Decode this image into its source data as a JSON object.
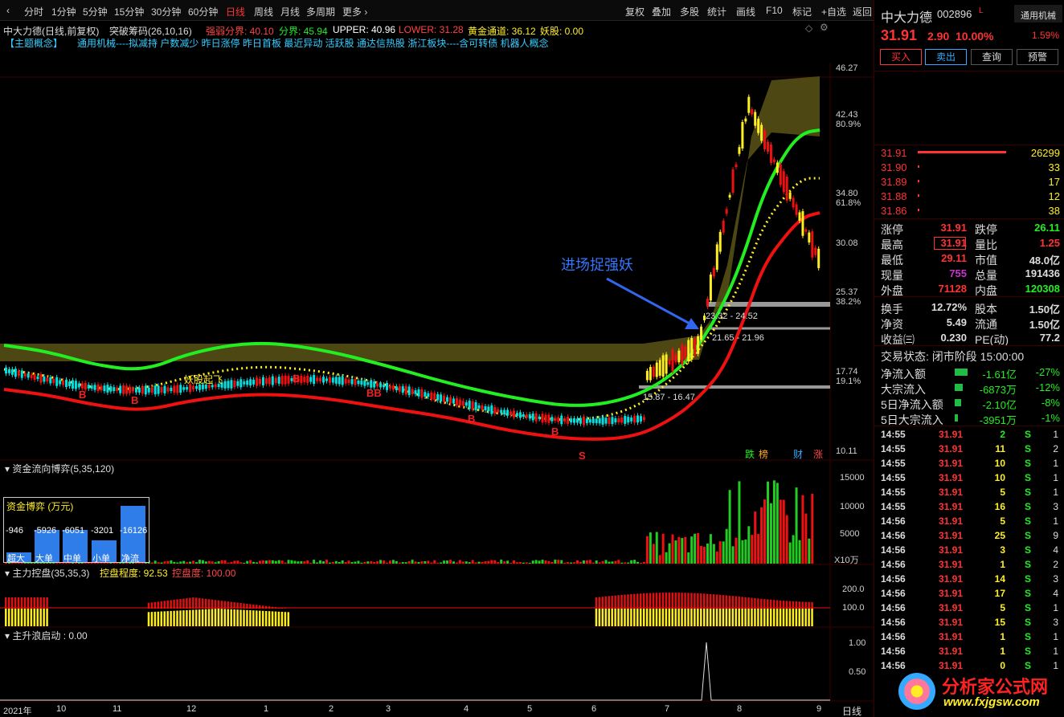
{
  "toolbar": {
    "periods": [
      "分时",
      "1分钟",
      "5分钟",
      "15分钟",
      "30分钟",
      "60分钟",
      "日线",
      "周线",
      "月线",
      "多周期",
      "更多"
    ],
    "active_period": "日线",
    "actions": [
      "复权",
      "叠加",
      "多股",
      "统计",
      "画线",
      "F10",
      "标记",
      "+自选",
      "返回"
    ]
  },
  "chart_header": {
    "stock": "中大力德(日线,前复权)",
    "indicator": "突破筹码(26,10,16)",
    "strong_weak": "强弱分界: 40.10",
    "divide": "分界: 45.94",
    "upper": "UPPER: 40.96",
    "lower": "LOWER: 31.28",
    "golden": "黄金通道: 36.12",
    "yaogu": "妖股: 0.00"
  },
  "concepts": {
    "label": "【主题概念】",
    "text": "通用机械----拟减持 户数减少 昨日涨停 昨日首板 最近异动 活跃股 通达信热股 浙江板块----含可转债 机器人概念"
  },
  "annotations": {
    "callout": "进场捉强妖",
    "yaogu_label": "妖股起飞",
    "range1": "23.32 - 24.52",
    "range2": "21.65 - 21.96",
    "range3": "15.87 - 16.47",
    "tags": [
      "跌",
      "榜",
      "财",
      "涨"
    ],
    "signals": [
      "B",
      "B",
      "B",
      "BB",
      "B",
      "B",
      "S"
    ]
  },
  "price_axis": {
    "labels": [
      "46.27",
      "42.43",
      "80.9%",
      "34.80",
      "61.8%",
      "30.08",
      "25.37",
      "38.2%",
      "17.74",
      "19.1%",
      "10.11"
    ]
  },
  "panel2": {
    "title": "资金流向博弈(5,35,120)",
    "box_title": "资金博弈 (万元)",
    "bars": [
      {
        "label": "超大",
        "value": "-946"
      },
      {
        "label": "大单",
        "value": "-5926"
      },
      {
        "label": "中单",
        "value": "-6051"
      },
      {
        "label": "小单",
        "value": "-3201"
      },
      {
        "label": "净流",
        "value": "-16126"
      }
    ],
    "y_labels": [
      "15000",
      "10000",
      "5000",
      "X10万"
    ]
  },
  "panel3": {
    "title": "主力控盘(35,35,3)",
    "degree": "控盘程度: 92.53",
    "level": "控盘度: 100.00",
    "y_labels": [
      "200.0",
      "100.0"
    ]
  },
  "panel4": {
    "title": "主升浪启动 : 0.00",
    "y_labels": [
      "1.00",
      "0.50"
    ]
  },
  "x_axis": {
    "labels": [
      "2021年",
      "10",
      "11",
      "12",
      "1",
      "2",
      "3",
      "4",
      "5",
      "6",
      "7",
      "8",
      "9"
    ],
    "period": "日线"
  },
  "quote": {
    "name": "中大力德",
    "code": "002896",
    "flag": "L",
    "sector": "通用机械",
    "price": "31.91",
    "change": "2.90",
    "pct": "10.00%",
    "turnover_pct": "1.59%",
    "buttons": [
      "买入",
      "卖出",
      "查询",
      "预警"
    ]
  },
  "order_book": [
    {
      "price": "31.91",
      "vol": "26299"
    },
    {
      "price": "31.90",
      "vol": "33"
    },
    {
      "price": "31.89",
      "vol": "17"
    },
    {
      "price": "31.88",
      "vol": "12"
    },
    {
      "price": "31.86",
      "vol": "38"
    }
  ],
  "stats": [
    [
      "涨停",
      "31.91",
      "跌停",
      "26.11"
    ],
    [
      "最高",
      "31.91",
      "量比",
      "1.25"
    ],
    [
      "最低",
      "29.11",
      "市值",
      "48.0亿"
    ],
    [
      "现量",
      "755",
      "总量",
      "191436"
    ],
    [
      "外盘",
      "71128",
      "内盘",
      "120308"
    ],
    [
      "换手",
      "12.72%",
      "股本",
      "1.50亿"
    ],
    [
      "净资",
      "5.49",
      "流通",
      "1.50亿"
    ],
    [
      "收益㈢",
      "0.230",
      "PE(动)",
      "77.2"
    ]
  ],
  "trade_status": "交易状态: 闭市阶段 15:00:00",
  "flows": [
    {
      "label": "净流入额",
      "value": "-1.61亿",
      "pct": "-27%"
    },
    {
      "label": "大宗流入",
      "value": "-6873万",
      "pct": "-12%"
    },
    {
      "label": "5日净流入额",
      "value": "-2.10亿",
      "pct": "-8%"
    },
    {
      "label": "5日大宗流入",
      "value": "-3951万",
      "pct": "-1%"
    }
  ],
  "ticks": [
    [
      "14:55",
      "31.91",
      "2",
      "S",
      "1"
    ],
    [
      "14:55",
      "31.91",
      "11",
      "S",
      "2"
    ],
    [
      "14:55",
      "31.91",
      "10",
      "S",
      "1"
    ],
    [
      "14:55",
      "31.91",
      "10",
      "S",
      "1"
    ],
    [
      "14:55",
      "31.91",
      "5",
      "S",
      "1"
    ],
    [
      "14:55",
      "31.91",
      "16",
      "S",
      "3"
    ],
    [
      "14:56",
      "31.91",
      "5",
      "S",
      "1"
    ],
    [
      "14:56",
      "31.91",
      "25",
      "S",
      "9"
    ],
    [
      "14:56",
      "31.91",
      "3",
      "S",
      "4"
    ],
    [
      "14:56",
      "31.91",
      "1",
      "S",
      "2"
    ],
    [
      "14:56",
      "31.91",
      "14",
      "S",
      "3"
    ],
    [
      "14:56",
      "31.91",
      "17",
      "S",
      "4"
    ],
    [
      "14:56",
      "31.91",
      "5",
      "S",
      "1"
    ],
    [
      "14:56",
      "31.91",
      "15",
      "S",
      "3"
    ],
    [
      "14:56",
      "31.91",
      "1",
      "S",
      "1"
    ],
    [
      "14:56",
      "31.91",
      "1",
      "S",
      "1"
    ],
    [
      "14:56",
      "31.91",
      "0",
      "S",
      "1"
    ]
  ],
  "watermark": {
    "title": "分析家公式网",
    "url": "www.fxjgsw.com"
  },
  "colors": {
    "up": "#ff3333",
    "down": "#00e0e0",
    "green": "#22ee22",
    "yellow": "#ffee22",
    "bg": "#000000",
    "grid": "#3a0000"
  }
}
